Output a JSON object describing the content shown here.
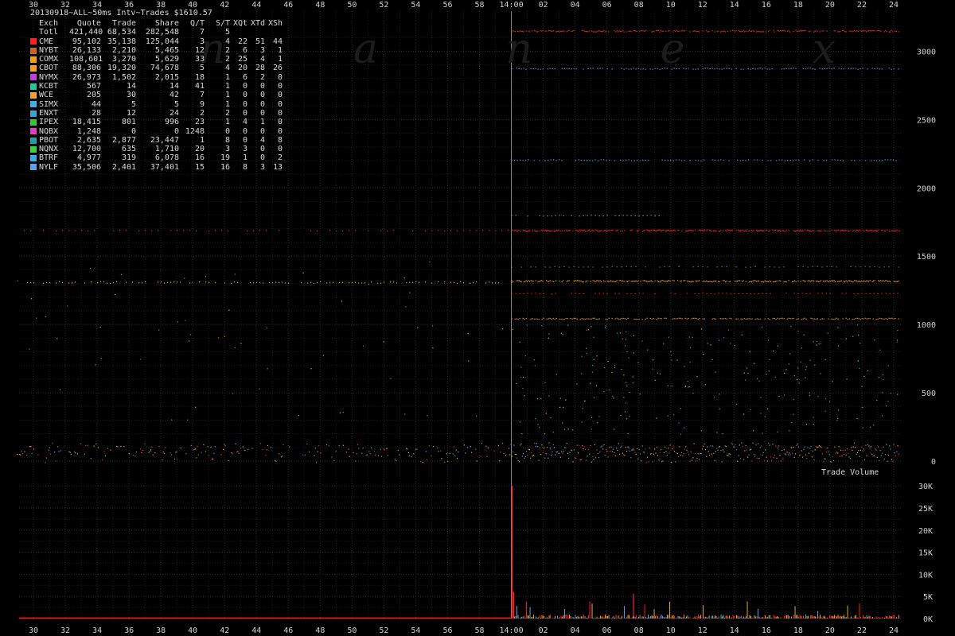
{
  "chart_data": {
    "type": "scatter",
    "title": "20130918~ALL~50ms Intv~Trades $1610.57",
    "watermark": "n a n e x",
    "x_ticks_top": [
      "30",
      "32",
      "34",
      "36",
      "38",
      "40",
      "42",
      "44",
      "46",
      "48",
      "50",
      "52",
      "54",
      "56",
      "58",
      "14:00",
      "02",
      "04",
      "06",
      "08",
      "10",
      "12",
      "14",
      "16",
      "18",
      "20",
      "22",
      "24"
    ],
    "x_ticks_bottom": [
      "30",
      "32",
      "34",
      "36",
      "38",
      "40",
      "42",
      "44",
      "46",
      "48",
      "50",
      "52",
      "54",
      "56",
      "58",
      "14:00",
      "02",
      "04",
      "06",
      "08",
      "10",
      "12",
      "14",
      "16",
      "18",
      "20",
      "22",
      "24"
    ],
    "y_ticks_main": [
      "3000",
      "2500",
      "2000",
      "1500",
      "1000",
      "500",
      "0"
    ],
    "y_range_main": [
      0,
      3200
    ],
    "y_ticks_volume": [
      "30K",
      "25K",
      "20K",
      "15K",
      "10K",
      "5K",
      "0K"
    ],
    "y_range_volume": [
      0,
      32000
    ],
    "volume_label": "Trade Volume",
    "grid": true,
    "legend_placement": "top-left",
    "legend_columns": [
      "Exch",
      "Quote",
      "Trade",
      "Share",
      "Q/T",
      "S/T",
      "XQt",
      "XTd",
      "XSh"
    ],
    "total_row": {
      "name": "Totl",
      "quote": "421,440",
      "trade": "68,534",
      "share": "282,548",
      "qt": "7",
      "st": "5",
      "xqt": "",
      "xtd": "",
      "xsh": ""
    },
    "exchanges": [
      {
        "name": "CME",
        "color": "#ff2020",
        "quote": "95,102",
        "trade": "35,138",
        "share": "125,044",
        "qt": "3",
        "st": "4",
        "xqt": "22",
        "xtd": "51",
        "xsh": "44"
      },
      {
        "name": "NYBT",
        "color": "#c86428",
        "quote": "26,133",
        "trade": "2,210",
        "share": "5,465",
        "qt": "12",
        "st": "2",
        "xqt": "6",
        "xtd": "3",
        "xsh": "1"
      },
      {
        "name": "COMX",
        "color": "#f0a020",
        "quote": "108,601",
        "trade": "3,270",
        "share": "5,629",
        "qt": "33",
        "st": "2",
        "xqt": "25",
        "xtd": "4",
        "xsh": "1"
      },
      {
        "name": "CBOT",
        "color": "#f0a030",
        "quote": "88,306",
        "trade": "19,320",
        "share": "74,678",
        "qt": "5",
        "st": "4",
        "xqt": "20",
        "xtd": "28",
        "xsh": "26"
      },
      {
        "name": "NYMX",
        "color": "#c040e0",
        "quote": "26,973",
        "trade": "1,502",
        "share": "2,015",
        "qt": "18",
        "st": "1",
        "xqt": "6",
        "xtd": "2",
        "xsh": "0"
      },
      {
        "name": "KCBT",
        "color": "#20c8a0",
        "quote": "567",
        "trade": "14",
        "share": "14",
        "qt": "41",
        "st": "1",
        "xqt": "0",
        "xtd": "0",
        "xsh": "0"
      },
      {
        "name": "WCE",
        "color": "#f0a040",
        "quote": "205",
        "trade": "30",
        "share": "42",
        "qt": "7",
        "st": "1",
        "xqt": "0",
        "xtd": "0",
        "xsh": "0"
      },
      {
        "name": "SIMX",
        "color": "#40b0e0",
        "quote": "44",
        "trade": "5",
        "share": "5",
        "qt": "9",
        "st": "1",
        "xqt": "0",
        "xtd": "0",
        "xsh": "0"
      },
      {
        "name": "ENXT",
        "color": "#40a0d0",
        "quote": "28",
        "trade": "12",
        "share": "24",
        "qt": "2",
        "st": "2",
        "xqt": "0",
        "xtd": "0",
        "xsh": "0"
      },
      {
        "name": "IPEX",
        "color": "#40c040",
        "quote": "18,415",
        "trade": "801",
        "share": "996",
        "qt": "23",
        "st": "1",
        "xqt": "4",
        "xtd": "1",
        "xsh": "0"
      },
      {
        "name": "NQBX",
        "color": "#e040c0",
        "quote": "1,248",
        "trade": "0",
        "share": "0",
        "qt": "1248",
        "st": "0",
        "xqt": "0",
        "xtd": "0",
        "xsh": "0"
      },
      {
        "name": "PBOT",
        "color": "#20a0a0",
        "quote": "2,635",
        "trade": "2,877",
        "share": "23,447",
        "qt": "1",
        "st": "8",
        "xqt": "0",
        "xtd": "4",
        "xsh": "8"
      },
      {
        "name": "NQNX",
        "color": "#40d040",
        "quote": "12,700",
        "trade": "635",
        "share": "1,710",
        "qt": "20",
        "st": "3",
        "xqt": "3",
        "xtd": "0",
        "xsh": "0"
      },
      {
        "name": "BTRF",
        "color": "#40a8e0",
        "quote": "4,977",
        "trade": "319",
        "share": "6,078",
        "qt": "16",
        "st": "19",
        "xqt": "1",
        "xtd": "0",
        "xsh": "2"
      },
      {
        "name": "NYLF",
        "color": "#60a0e0",
        "quote": "35,506",
        "trade": "2,401",
        "share": "37,401",
        "qt": "15",
        "st": "16",
        "xqt": "8",
        "xtd": "3",
        "xsh": "13"
      }
    ]
  }
}
